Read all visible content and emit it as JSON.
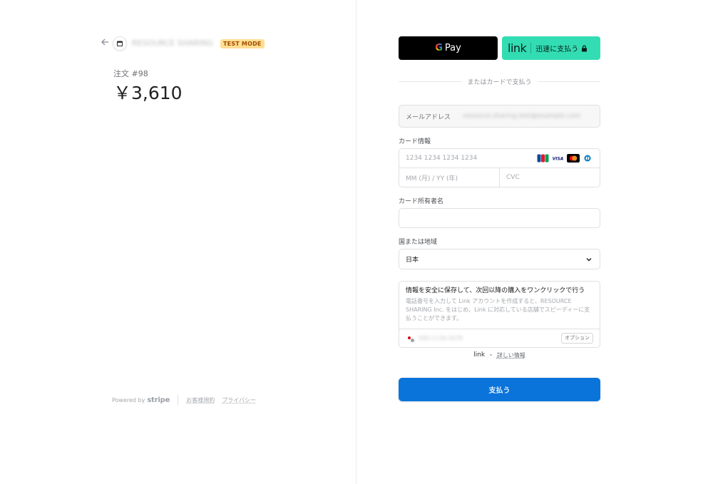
{
  "header": {
    "back_icon": "arrow-left-icon",
    "merchant_icon": "store-icon",
    "merchant_name": "RESOURCE SHARING Inc.",
    "test_mode": "TEST MODE"
  },
  "order": {
    "label": "注文 #98",
    "amount": "￥3,610"
  },
  "footer": {
    "powered_by": "Powered by",
    "stripe": "stripe",
    "terms": "お客様規約",
    "privacy": "プライバシー"
  },
  "express": {
    "gpay_g": "G",
    "gpay_label": "Pay",
    "link_logo": "link",
    "link_label": "迅速に支払う",
    "lock_icon": "lock-icon"
  },
  "divider": {
    "text": "またはカードで支払う"
  },
  "email": {
    "label": "メールアドレス",
    "value": "resource.sharing.test@example.com"
  },
  "card": {
    "label": "カード情報",
    "number_placeholder": "1234 1234 1234 1234",
    "expiry_placeholder": "MM (月) / YY (年)",
    "cvc_placeholder": "CVC",
    "brand_icons": [
      "jcb-icon",
      "visa-icon",
      "mastercard-icon",
      "diners-icon"
    ],
    "visa_text": "VISA"
  },
  "holder": {
    "label": "カード所有者名",
    "value": ""
  },
  "country": {
    "label": "国または地域",
    "selected": "日本"
  },
  "save": {
    "title": "情報を安全に保存して、次回以降の購入をワンクリックで行う",
    "description": "電話番号を入力して Link アカウントを作成すると、RESOURCE SHARING Inc. をはじめ、Link に対応している店舗でスピーディーに支払うことができます。",
    "phone_flag": "japan-flag-icon",
    "phone_value": "090-1234-5678",
    "optional": "オプション"
  },
  "link_footer": {
    "logo": "link",
    "separator": "•",
    "more": "詳しい情報"
  },
  "pay": {
    "label": "支払う"
  },
  "colors": {
    "pay_button": "#0a74da",
    "link_button": "#33ddb3",
    "test_badge_bg": "#ffde92",
    "test_badge_text": "#a04b00"
  }
}
